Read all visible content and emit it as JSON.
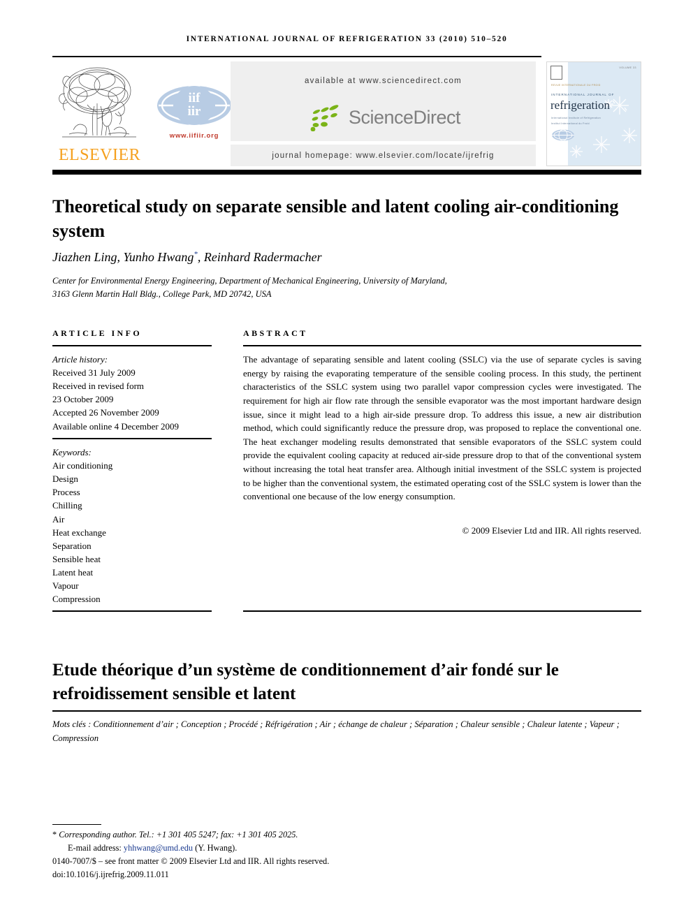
{
  "running_head": "International Journal of Refrigeration 33 (2010) 510–520",
  "banner": {
    "elsevier_wordmark": "ELSEVIER",
    "iif_url": "www.iifiir.org",
    "available_at": "available at www.sciencedirect.com",
    "sciencedirect_wordmark": "ScienceDirect",
    "journal_homepage": "journal homepage: www.elsevier.com/locate/ijrefrig",
    "accent_orange": "#F5A01E",
    "accent_green": "#7AB317",
    "accent_grey": "#7f7f7f",
    "iif_blue": "#B8CCE4",
    "iif_red": "#C0392B"
  },
  "cover": {
    "top_right": "VOLUME 33",
    "tag": "REVUE INTERNATIONALE DU FROID",
    "eyebrow": "INTERNATIONAL JOURNAL OF",
    "title": "refrigeration",
    "sub1": "International Institute of Refrigeration",
    "sub2": "Institut International du Froid",
    "bg_color": "#dce9f4"
  },
  "article": {
    "title": "Theoretical study on separate sensible and latent cooling air-conditioning system",
    "authors": "Jiazhen Ling, Yunho Hwang",
    "authors_tail": ", Reinhard Radermacher",
    "corresponding_marker": "*",
    "affiliation_line1": "Center for Environmental Energy Engineering, Department of Mechanical Engineering, University of Maryland,",
    "affiliation_line2": "3163 Glenn Martin Hall Bldg., College Park, MD 20742, USA"
  },
  "sections": {
    "article_info_heading": "Article info",
    "abstract_heading": "Abstract"
  },
  "article_info": {
    "history_label": "Article history:",
    "history": [
      "Received 31 July 2009",
      "Received in revised form",
      "23 October 2009",
      "Accepted 26 November 2009",
      "Available online 4 December 2009"
    ],
    "keywords_label": "Keywords:",
    "keywords": [
      "Air conditioning",
      "Design",
      "Process",
      "Chilling",
      "Air",
      "Heat exchange",
      "Separation",
      "Sensible heat",
      "Latent heat",
      "Vapour",
      "Compression"
    ]
  },
  "abstract": {
    "text": "The advantage of separating sensible and latent cooling (SSLC) via the use of separate cycles is saving energy by raising the evaporating temperature of the sensible cooling process. In this study, the pertinent characteristics of the SSLC system using two parallel vapor compression cycles were investigated. The requirement for high air flow rate through the sensible evaporator was the most important hardware design issue, since it might lead to a high air-side pressure drop. To address this issue, a new air distribution method, which could significantly reduce the pressure drop, was proposed to replace the conventional one. The heat exchanger modeling results demonstrated that sensible evaporators of the SSLC system could provide the equivalent cooling capacity at reduced air-side pressure drop to that of the conventional system without increasing the total heat transfer area. Although initial investment of the SSLC system is projected to be higher than the conventional system, the estimated operating cost of the SSLC system is lower than the conventional one because of the low energy consumption.",
    "copyright": "© 2009 Elsevier Ltd and IIR. All rights reserved."
  },
  "french": {
    "title": "Etude théorique d’un système de conditionnement d’air fondé sur le refroidissement sensible et latent",
    "keywords_label": "Mots clés :",
    "keywords_text": "Conditionnement d’air ; Conception ; Procédé ; Réfrigération ; Air ; échange de chaleur ; Séparation ; Chaleur sensible ; Chaleur latente ; Vapeur ; Compression"
  },
  "footnote": {
    "corresponding_star": "*",
    "corresponding": "Corresponding author. Tel.: +1 301 405 5247; fax: +1 301 405 2025.",
    "email_label": "E-mail address:",
    "email": "yhhwang@umd.edu",
    "email_owner": "(Y. Hwang).",
    "issn_line": "0140-7007/$ – see front matter © 2009 Elsevier Ltd and IIR. All rights reserved.",
    "doi": "doi:10.1016/j.ijrefrig.2009.11.011",
    "link_color": "#1a3a8f"
  }
}
